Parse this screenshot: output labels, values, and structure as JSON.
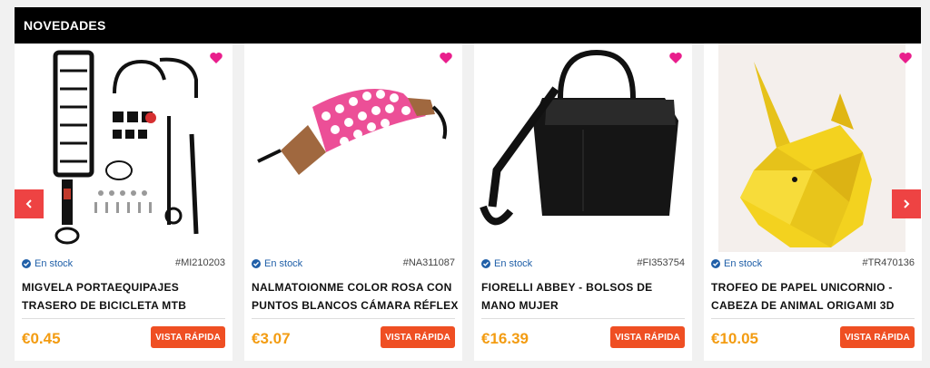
{
  "section": {
    "title": "NOVEDADES"
  },
  "colors": {
    "accent": "#ef4f23",
    "price": "#f39c12",
    "stock": "#1f5fa8",
    "heart": "#e91e8c",
    "arrow": "#ee4343"
  },
  "products": [
    {
      "stock": "En stock",
      "sku": "#MI210203",
      "title": "MIGVELA PORTAEQUIPAJES TRASERO DE BICICLETA MTB ASIENTO DEL",
      "price": "€0.45",
      "cta": "VISTA RÁPIDA",
      "icon": "bike-rack-image"
    },
    {
      "stock": "En stock",
      "sku": "#NA311087",
      "title": "NALMATOIONME COLOR ROSA CON PUNTOS BLANCOS CÁMARA RÉFLEX",
      "price": "€3.07",
      "cta": "VISTA RÁPIDA",
      "icon": "camera-strap-image"
    },
    {
      "stock": "En stock",
      "sku": "#FI353754",
      "title": "FIORELLI ABBEY - BOLSOS DE MANO MUJER",
      "price": "€16.39",
      "cta": "VISTA RÁPIDA",
      "icon": "handbag-image"
    },
    {
      "stock": "En stock",
      "sku": "#TR470136",
      "title": "TROFEO DE PAPEL UNICORNIO - CABEZA DE ANIMAL ORIGAMI 3D",
      "price": "€10.05",
      "cta": "VISTA RÁPIDA",
      "icon": "unicorn-trophy-image"
    }
  ],
  "nav": {
    "prev": "chevron-left-icon",
    "next": "chevron-right-icon"
  }
}
